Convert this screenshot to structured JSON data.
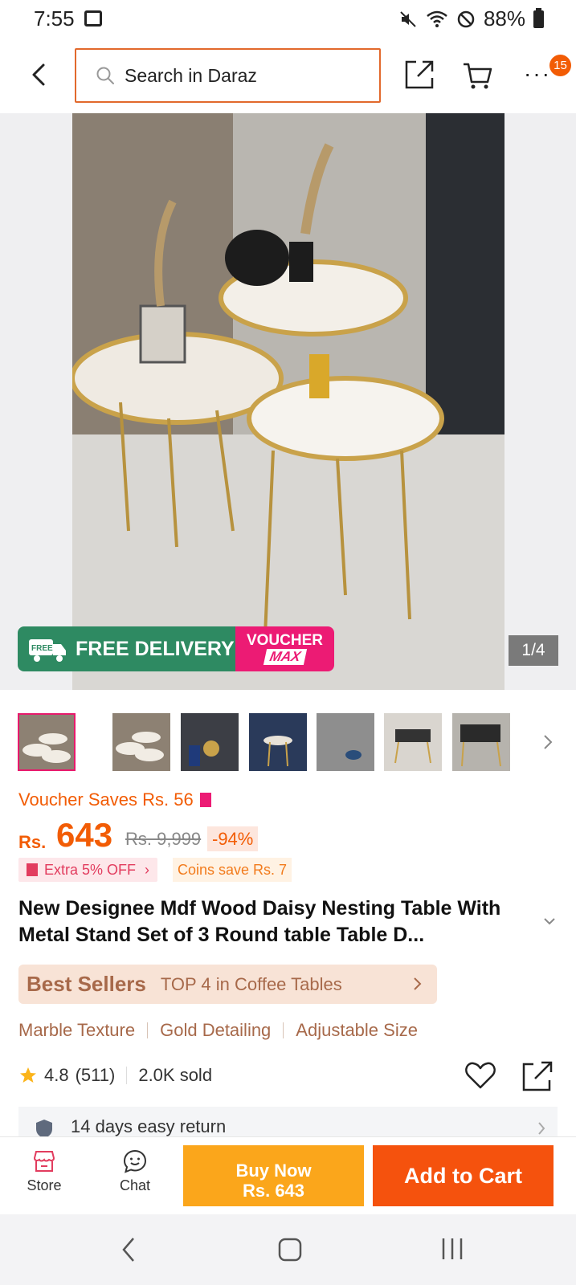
{
  "status_bar": {
    "time": "7:55",
    "battery": "88%"
  },
  "header": {
    "search_placeholder": "Search in Daraz",
    "notification_count": "15",
    "accent_color": "#e2692c"
  },
  "hero": {
    "delivery_label": "FREE DELIVERY",
    "free_tag": "FREE",
    "voucher_line1": "VOUCHER",
    "voucher_line2": "MAX",
    "pager": "1/4"
  },
  "thumbnails": [
    {
      "name": "thumb-1"
    },
    {
      "name": "thumb-2"
    },
    {
      "name": "thumb-3"
    },
    {
      "name": "thumb-4"
    },
    {
      "name": "thumb-5"
    },
    {
      "name": "thumb-6"
    },
    {
      "name": "thumb-7"
    }
  ],
  "price": {
    "voucher_saves": "Voucher Saves Rs. 56",
    "currency": "Rs.",
    "current": "643",
    "original": "Rs. 9,999",
    "discount": "-94%",
    "extra_off": "Extra 5% OFF",
    "coins": "Coins save Rs. 7",
    "price_color": "#f25c05"
  },
  "product": {
    "title": "New Designee Mdf Wood Daisy Nesting Table With Metal Stand Set of 3 Round table Table D...",
    "best_sellers_label": "Best Sellers",
    "best_sellers_rank": "TOP 4 in Coffee Tables",
    "features": [
      "Marble Texture",
      "Gold Detailing",
      "Adjustable Size"
    ],
    "rating": "4.8",
    "reviews": "(511)",
    "sold": "2.0K sold",
    "returns": "14 days easy return"
  },
  "bottom_bar": {
    "store_label": "Store",
    "chat_label": "Chat",
    "buy_now_label": "Buy Now",
    "buy_now_price": "Rs. 643",
    "add_to_cart_label": "Add to Cart",
    "buy_now_color": "#fba61b",
    "add_to_cart_color": "#f5520d"
  }
}
